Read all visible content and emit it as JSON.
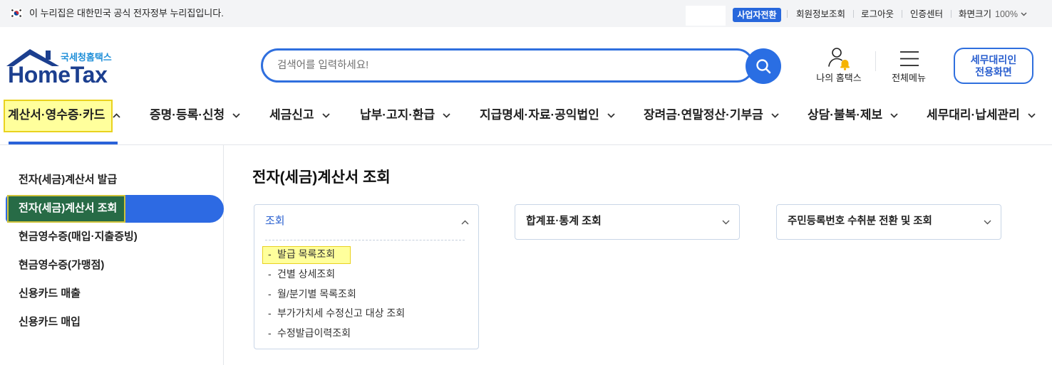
{
  "notice_bar": {
    "text": "이 누리집은 대한민국 공식 전자정부 누리집입니다.",
    "business_switch": "사업자전환",
    "member_info": "회원정보조회",
    "logout": "로그아웃",
    "cert_center": "인증센터",
    "screen_size_label": "화면크기",
    "screen_size_value": "100%"
  },
  "header": {
    "logo_subtitle": "국세청홈택스",
    "logo_title": "HomeTax",
    "search": {
      "placeholder": "검색어를 입력하세요!",
      "value": ""
    },
    "my_hometax_label": "나의 홈택스",
    "all_menu_label": "전체메뉴",
    "agent_button": {
      "line1": "세무대리인",
      "line2": "전용화면"
    }
  },
  "gnb": {
    "items": [
      {
        "label": "계산서·영수증·카드",
        "expanded": true,
        "active": true,
        "highlighted": true
      },
      {
        "label": "증명·등록·신청",
        "expanded": false
      },
      {
        "label": "세금신고",
        "expanded": false
      },
      {
        "label": "납부·고지·환급",
        "expanded": false
      },
      {
        "label": "지급명세·자료·공익법인",
        "expanded": false
      },
      {
        "label": "장려금·연말정산·기부금",
        "expanded": false
      },
      {
        "label": "상담·불복·제보",
        "expanded": false
      },
      {
        "label": "세무대리·납세관리",
        "expanded": false
      }
    ]
  },
  "sidebar": {
    "items": [
      {
        "label": "전자(세금)계산서 발급",
        "active": false
      },
      {
        "label": "전자(세금)계산서 조회",
        "active": true,
        "highlighted": true
      },
      {
        "label": "현금영수증(매입·지출증빙)",
        "active": false
      },
      {
        "label": "현금영수증(가맹점)",
        "active": false
      },
      {
        "label": "신용카드 매출",
        "active": false
      },
      {
        "label": "신용카드 매입",
        "active": false
      }
    ]
  },
  "main": {
    "title": "전자(세금)계산서 조회",
    "panels": [
      {
        "title": "조회",
        "expanded": true,
        "items": [
          {
            "label": "발급 목록조회",
            "highlighted": true
          },
          {
            "label": "건별 상세조회"
          },
          {
            "label": "월/분기별 목록조회"
          },
          {
            "label": "부가가치세 수정신고 대상 조회"
          },
          {
            "label": "수정발급이력조회"
          }
        ]
      },
      {
        "title": "합계표·통계 조회",
        "expanded": false
      },
      {
        "title": "주민등록번호 수취분 전환 및 조회",
        "expanded": false
      }
    ]
  },
  "icons": {
    "flag": "korea-flag-icon",
    "logo": "house-roof-logo-icon",
    "search": "search-icon",
    "my_hometax": "user-bell-icon",
    "all_menu": "hamburger-menu-icon",
    "expand": "chevron-down-icon",
    "collapse": "chevron-up-icon"
  },
  "colors": {
    "accent_blue": "#2d6ae3",
    "search_border": "#2f6fde",
    "logo_navy": "#1c3f8f",
    "logo_teal": "#1f8fd8",
    "notice_bar_bg": "#f3f4f6",
    "panel_border": "#c9d6e7",
    "highlight_yellow": "#ffff9c",
    "highlight_border": "#e9d21f",
    "active_mark_green": "#276b46",
    "bell_yellow": "#f5b301"
  }
}
